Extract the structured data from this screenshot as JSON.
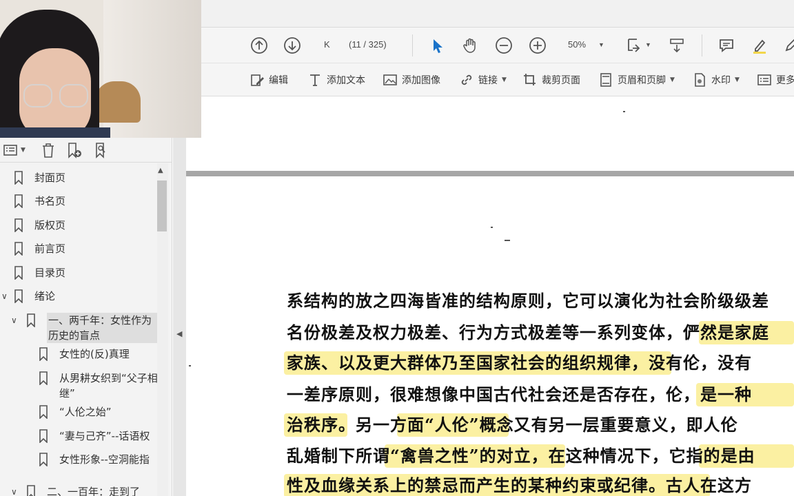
{
  "toolbar": {
    "page_input": "K",
    "page_count": "(11 / 325)",
    "zoom": "50%"
  },
  "edit_bar": {
    "edit": "编辑",
    "add_text": "添加文本",
    "add_image": "添加图像",
    "link": "链接",
    "crop": "裁剪页面",
    "header_footer": "页眉和页脚",
    "watermark": "水印",
    "more": "更多"
  },
  "bookmarks": [
    {
      "label": "封面页"
    },
    {
      "label": "书名页"
    },
    {
      "label": "版权页"
    },
    {
      "label": "前言页"
    },
    {
      "label": "目录页"
    },
    {
      "label": "绪论"
    },
    {
      "label": "一、两千年：女性作为历史的盲点"
    },
    {
      "label": "女性的(反)真理"
    },
    {
      "label": "从男耕女织到“父子相继”"
    },
    {
      "label": "“人伦之始”"
    },
    {
      "label": "“妻与己齐”--话语权"
    },
    {
      "label": "女性形象--空洞能指"
    },
    {
      "label": "二、一百年：走到了"
    }
  ],
  "document": {
    "lines": [
      "系结构的放之四海皆准的结构原则，它可以演化为社会阶级级差",
      "名份极差及权力极差、行为方式极差等一系列变体，俨然是家庭",
      "家族、以及更大群体乃至国家社会的组织规律，没有伦，没有",
      "一差序原则，很难想像中国古代社会还是否存在，伦，是一种",
      "治秩序。另一方面“人伦”概念又有另一层重要意义，即人伦",
      "乱婚制下所谓“禽兽之性”的对立，在这种情况下，它指的是由",
      "性及血缘关系上的禁忌而产生的某种约束或纪律。古人在这方"
    ]
  },
  "colors": {
    "highlight": "#fbf0a2",
    "toolbar_bg": "#f5f5f5",
    "panel_bg": "#f3f3f3",
    "page_divider": "#a6a6a6",
    "cursor_accent": "#1a73c9"
  }
}
